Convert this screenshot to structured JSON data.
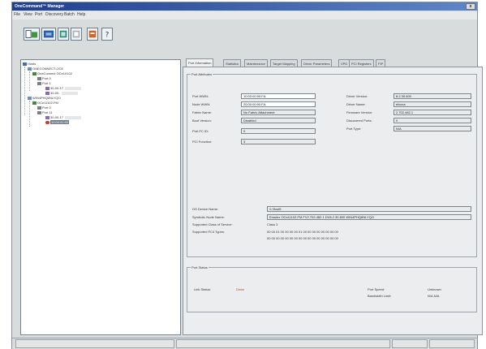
{
  "window": {
    "title": "OneCommand™ Manager",
    "close_label": "x"
  },
  "menu": [
    "File",
    "View",
    "Port",
    "Discovery",
    "Batch",
    "Help"
  ],
  "toolbar": [
    "host-view-icon",
    "fabric-view-icon",
    "discover-icon",
    "reset-icon",
    "batch-icon",
    "help-icon"
  ],
  "tree": {
    "nodes": [
      {
        "label": "Hosts",
        "icon": "hosts-icon"
      },
      {
        "label": "ONECONNECT-OCE",
        "icon": "host-icon"
      },
      {
        "label": "OneConnect OCe10102",
        "icon": "adapter-icon"
      },
      {
        "label": "Port 0",
        "icon": "port-icon"
      },
      {
        "label": "Port 1",
        "icon": "port-icon"
      },
      {
        "label": "30-00-17",
        "icon": "function-icon"
      },
      {
        "label": "30-00-",
        "icon": "function-icon"
      },
      {
        "label": "WIN4PHQ6NLYQO",
        "icon": "host-icon"
      },
      {
        "label": "OCe11102-FM",
        "icon": "adapter-icon"
      },
      {
        "label": "Port 0",
        "icon": "port-icon"
      },
      {
        "label": "Port 11",
        "icon": "port-icon"
      },
      {
        "label": "30-00-17",
        "icon": "function-icon"
      },
      {
        "label": "10:00:00:90",
        "icon": "function-icon"
      }
    ]
  },
  "tabs": [
    "Port Information",
    "Statistics",
    "Maintenance",
    "Target Mapping",
    "Driver Parameters",
    "VPD",
    "PCI Registers",
    "FIP"
  ],
  "port_attributes": {
    "title": "Port Attributes",
    "left_fields": [
      {
        "label": "Port WWN:",
        "value": "10:00:00:90:FA:"
      },
      {
        "label": "Node WWN:",
        "value": "20:00:00:90:FA:"
      },
      {
        "label": "Fabric Name:",
        "value": "No Fabric Attachment"
      },
      {
        "label": "Boot Version:",
        "value": "Disabled"
      },
      {
        "label": "Port FC ID:",
        "value": "0"
      },
      {
        "label": "PCI Function:",
        "value": "3"
      }
    ],
    "right_fields": [
      {
        "label": "Driver Version:",
        "value": "8.2.30.600"
      },
      {
        "label": "Driver Name:",
        "value": "elxcna"
      },
      {
        "label": "Firmware Version:",
        "value": "2.702.482.1"
      },
      {
        "label": "Discovered Ports:",
        "value": "0"
      },
      {
        "label": "Port Type:",
        "value": "N/A"
      }
    ],
    "os_device_label": "OS Device Name:",
    "os_device_value": "\\\\.\\Scsi0:",
    "symbolic_label": "Symbolic Node Name:",
    "symbolic_value": "Emulex OCe11102-FM FV2.702.482.1 DV8.2.30.600 WIN4PHQ6NLYQO",
    "supported_cos_label": "Supported Class of Service:",
    "supported_cos_value": "Class 3",
    "supported_fc4_label": "Supported FC4 Types:",
    "supported_fc4_row1": "00 00 01 00 00 00 00 01 00 00 00 00 00 00 00 00",
    "supported_fc4_row2": "00 00 00 00 00 00 00 00 00 00 00 00 00 00 00 00"
  },
  "port_status": {
    "title": "Port Status",
    "link_label": "Link Status:",
    "link_value": "Down",
    "speed_label": "Port Speed:",
    "speed_value": "Unknown",
    "bandwidth_label": "Bandwidth Limit:",
    "bandwidth_value": "N/A,N/A"
  },
  "colors": {
    "titlebar": "#1f3f8f",
    "down": "#c8402a",
    "selection": "#6f7b88"
  }
}
